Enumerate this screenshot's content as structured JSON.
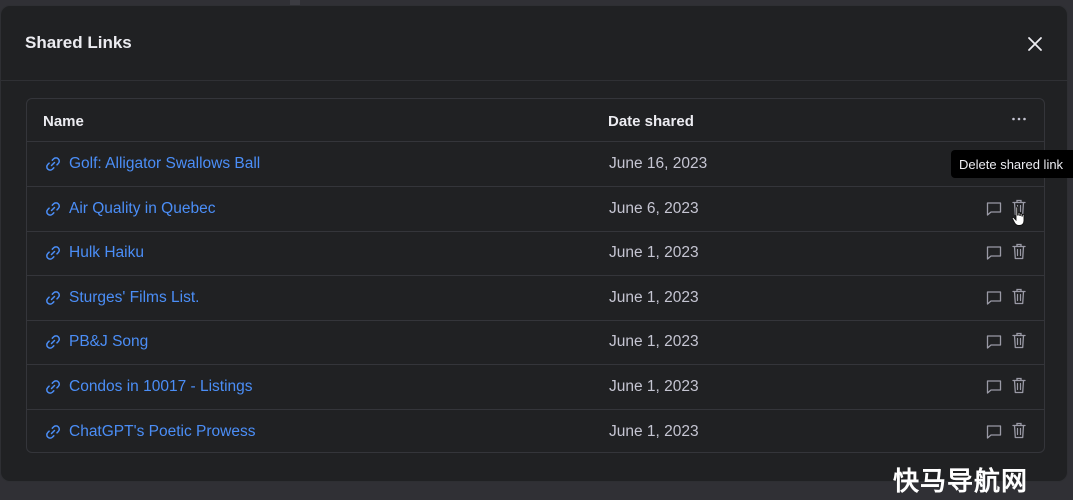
{
  "modal": {
    "title": "Shared Links",
    "close_icon": "close-icon"
  },
  "table": {
    "columns": {
      "name": "Name",
      "date": "Date shared",
      "more_icon": "more-horizontal-icon"
    },
    "rows": [
      {
        "name": "Golf: Alligator Swallows Ball",
        "date": "June 16, 2023"
      },
      {
        "name": "Air Quality in Quebec",
        "date": "June 6, 2023"
      },
      {
        "name": "Hulk Haiku",
        "date": "June 1, 2023"
      },
      {
        "name": "Sturges' Films List.",
        "date": "June 1, 2023"
      },
      {
        "name": "PB&J Song",
        "date": "June 1, 2023"
      },
      {
        "name": "Condos in 10017 - Listings",
        "date": "June 1, 2023"
      },
      {
        "name": "ChatGPT's Poetic Prowess",
        "date": "June 1, 2023"
      }
    ]
  },
  "tooltip": {
    "text": "Delete shared link"
  },
  "watermark": {
    "text": "快马导航网"
  },
  "colors": {
    "modal_bg": "#202123",
    "link": "#4b8ef7",
    "text": "#ececf1",
    "muted": "#c5c5d2",
    "border": "#34353a"
  }
}
